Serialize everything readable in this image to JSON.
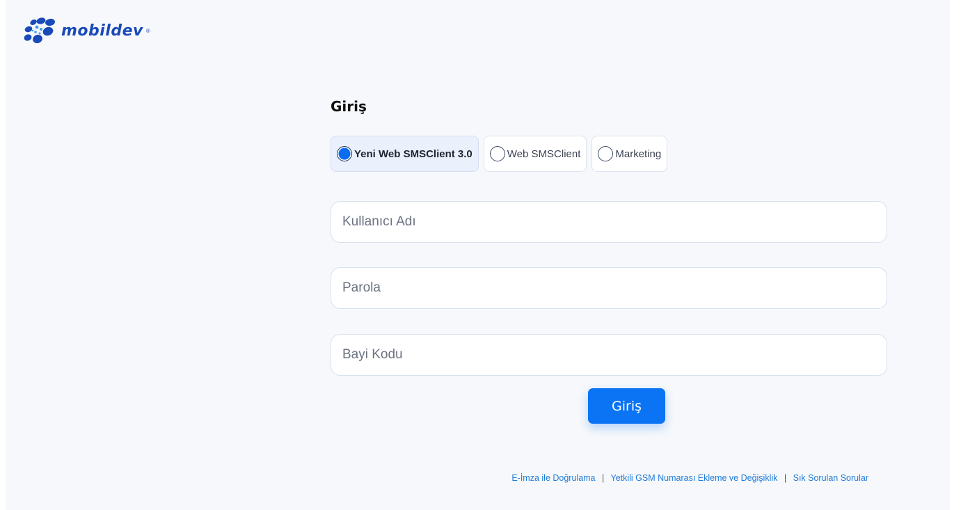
{
  "brand": {
    "name": "mobildev",
    "registered": "®",
    "color": "#1a49b8"
  },
  "login": {
    "title": "Giriş",
    "modes": [
      {
        "label": "Yeni Web SMSClient 3.0",
        "selected": true
      },
      {
        "label": "Web SMSClient",
        "selected": false
      },
      {
        "label": "Marketing",
        "selected": false
      }
    ],
    "username": {
      "placeholder": "Kullanıcı Adı",
      "value": ""
    },
    "password": {
      "placeholder": "Parola",
      "value": ""
    },
    "dealer_code": {
      "placeholder": "Bayi Kodu",
      "value": ""
    },
    "submit_label": "Giriş",
    "accent_color": "#0a74f5"
  },
  "footer": {
    "links": [
      "E-İmza ile Doğrulama",
      "Yetkili GSM Numarası Ekleme ve Değişiklik",
      "Sık Sorulan Sorular"
    ],
    "separator": "|"
  },
  "icons": {
    "logo": "mobildev-flower-logo",
    "radio_checked": "radio-checked-icon",
    "radio_unchecked": "radio-unchecked-icon"
  }
}
